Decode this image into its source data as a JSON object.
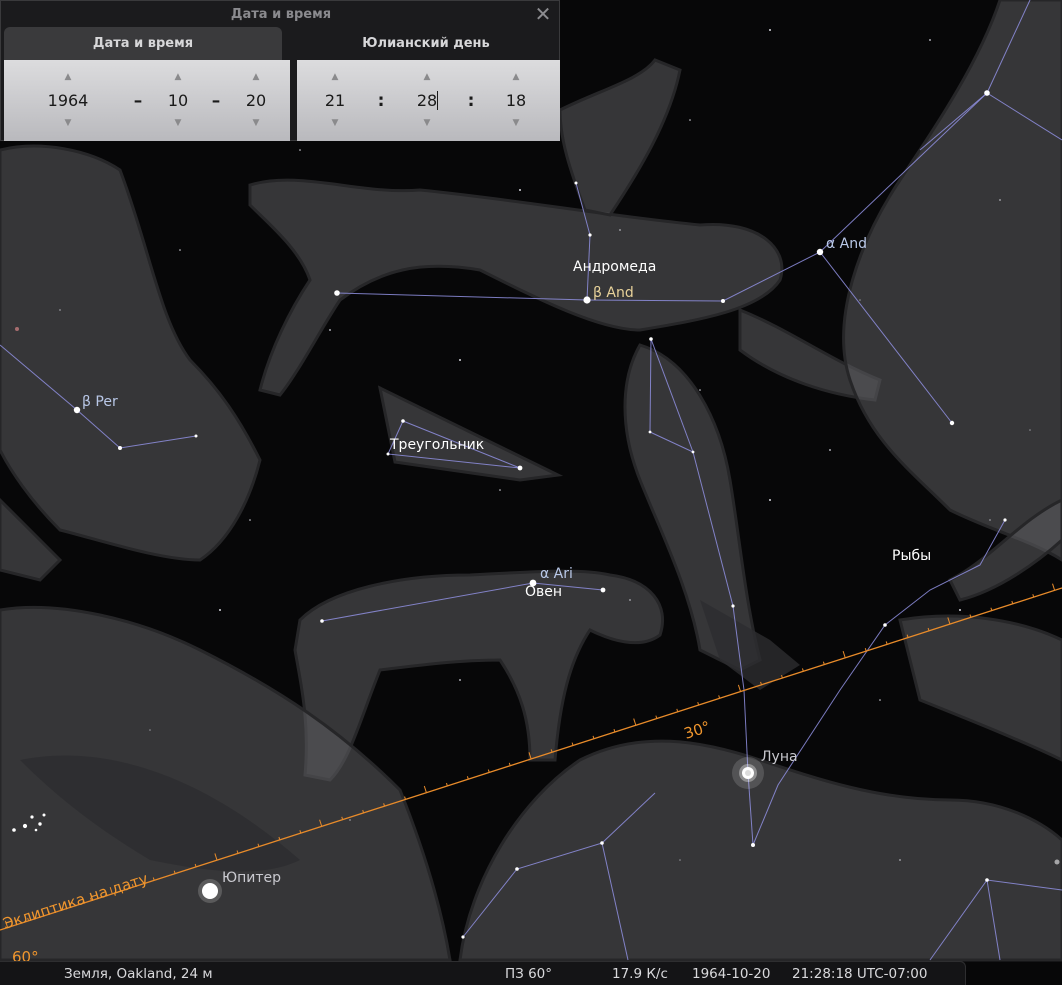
{
  "dialog": {
    "title": "Дата и время",
    "tabs": [
      {
        "label": "Дата и время",
        "active": true
      },
      {
        "label": "Юлианский день",
        "active": false
      }
    ],
    "date": {
      "year": "1964",
      "month": "10",
      "day": "20",
      "separator": "–"
    },
    "time": {
      "hour": "21",
      "minute": "28",
      "second": "18",
      "separator": ":"
    }
  },
  "sky": {
    "constellations": {
      "andromeda": "Андромеда",
      "triangulum": "Треугольник",
      "aries": "Овен",
      "pisces": "Рыбы"
    },
    "stars": {
      "alpha_and": "α And",
      "beta_and": "β And",
      "beta_per": "β Per",
      "alpha_ari": "α Ari"
    },
    "planets": {
      "moon": "Луна",
      "jupiter": "Юпитер"
    },
    "ecliptic": {
      "label": "Эклиптика на дату",
      "tick_30": "30°",
      "tick_60": "60°"
    }
  },
  "statusbar": {
    "location": "Земля, Oakland, 24 м",
    "fov": "ПЗ 60°",
    "fps": "17.9 К/с",
    "datetime_behind": "1964-10-20",
    "datetime": "21:28:18 UTC-07:00"
  },
  "colors": {
    "ecliptic": "#e88b2a",
    "constellation_lines": "#8f8fe0",
    "sky": "#070708"
  }
}
